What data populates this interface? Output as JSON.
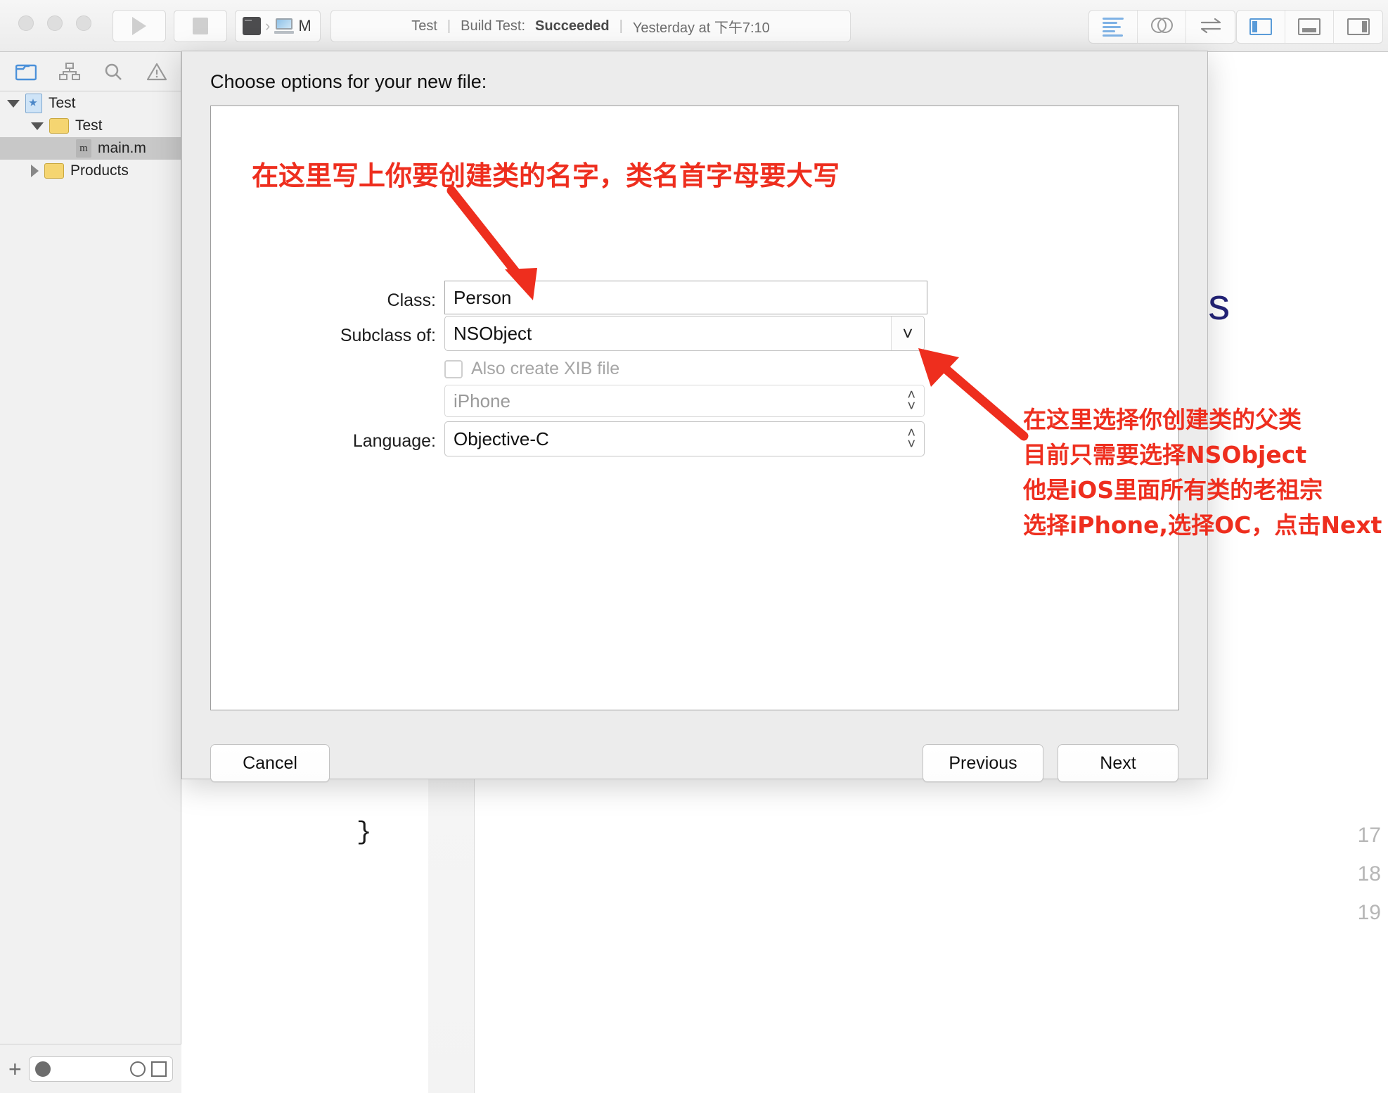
{
  "window": {
    "toolbar": {
      "run_button": "run-icon",
      "stop_button": "stop-icon",
      "scheme_label": "M",
      "status": {
        "project": "Test",
        "sep": "|",
        "build": "Build Test:",
        "build_result": "Succeeded",
        "time": "Yesterday at 下午7:10"
      },
      "editor_segments": [
        "standard-editor-icon",
        "assistant-editor-icon",
        "version-editor-icon"
      ],
      "view_segments": [
        "navigator-toggle-icon",
        "debug-area-toggle-icon",
        "utilities-toggle-icon"
      ]
    }
  },
  "navigator": {
    "tabs": [
      {
        "name": "project-navigator-tab",
        "icon": "folder-icon"
      },
      {
        "name": "symbol-navigator-tab",
        "icon": "hierarchy-icon"
      },
      {
        "name": "find-navigator-tab",
        "icon": "search-icon"
      },
      {
        "name": "issue-navigator-tab",
        "icon": "warning-icon"
      }
    ],
    "tree": [
      {
        "label": "Test",
        "icon": "xcode-project-icon",
        "disclosure": "open",
        "indent": 1,
        "selected": false
      },
      {
        "label": "Test",
        "icon": "folder-icon",
        "disclosure": "open",
        "indent": 2,
        "selected": false
      },
      {
        "label": "main.m",
        "icon": "objc-file-icon",
        "disclosure": "none",
        "indent": 3,
        "selected": true
      },
      {
        "label": "Products",
        "icon": "folder-icon",
        "disclosure": "closed",
        "indent": 2,
        "selected": false
      }
    ],
    "bottom_bar": {
      "add_label": "+",
      "filter_placeholder": "",
      "icons": [
        "filter-recent-icon",
        "clock-icon",
        "source-control-icon"
      ]
    }
  },
  "editor": {
    "line_numbers": [
      "17",
      "18",
      "19"
    ],
    "code_glyph": "}",
    "background_word": "ts"
  },
  "sheet": {
    "title": "Choose options for your new file:",
    "fields": {
      "class_label": "Class:",
      "class_value": "Person",
      "subclass_label": "Subclass of:",
      "subclass_value": "NSObject",
      "xib_label": "Also create XIB file",
      "xib_checked": false,
      "device_value": "iPhone",
      "language_label": "Language:",
      "language_value": "Objective-C"
    },
    "buttons": {
      "cancel": "Cancel",
      "previous": "Previous",
      "next": "Next"
    }
  },
  "annotations": {
    "color": "#ee2e1e",
    "class_name_note": "在这里写上你要创建类的名字，类名首字母要大写",
    "subclass_notes": [
      "在这里选择你创建类的父类",
      "目前只需要选择NSObject",
      "他是iOS里面所有类的老祖宗",
      "选择iPhone,选择OC，点击Next"
    ]
  }
}
